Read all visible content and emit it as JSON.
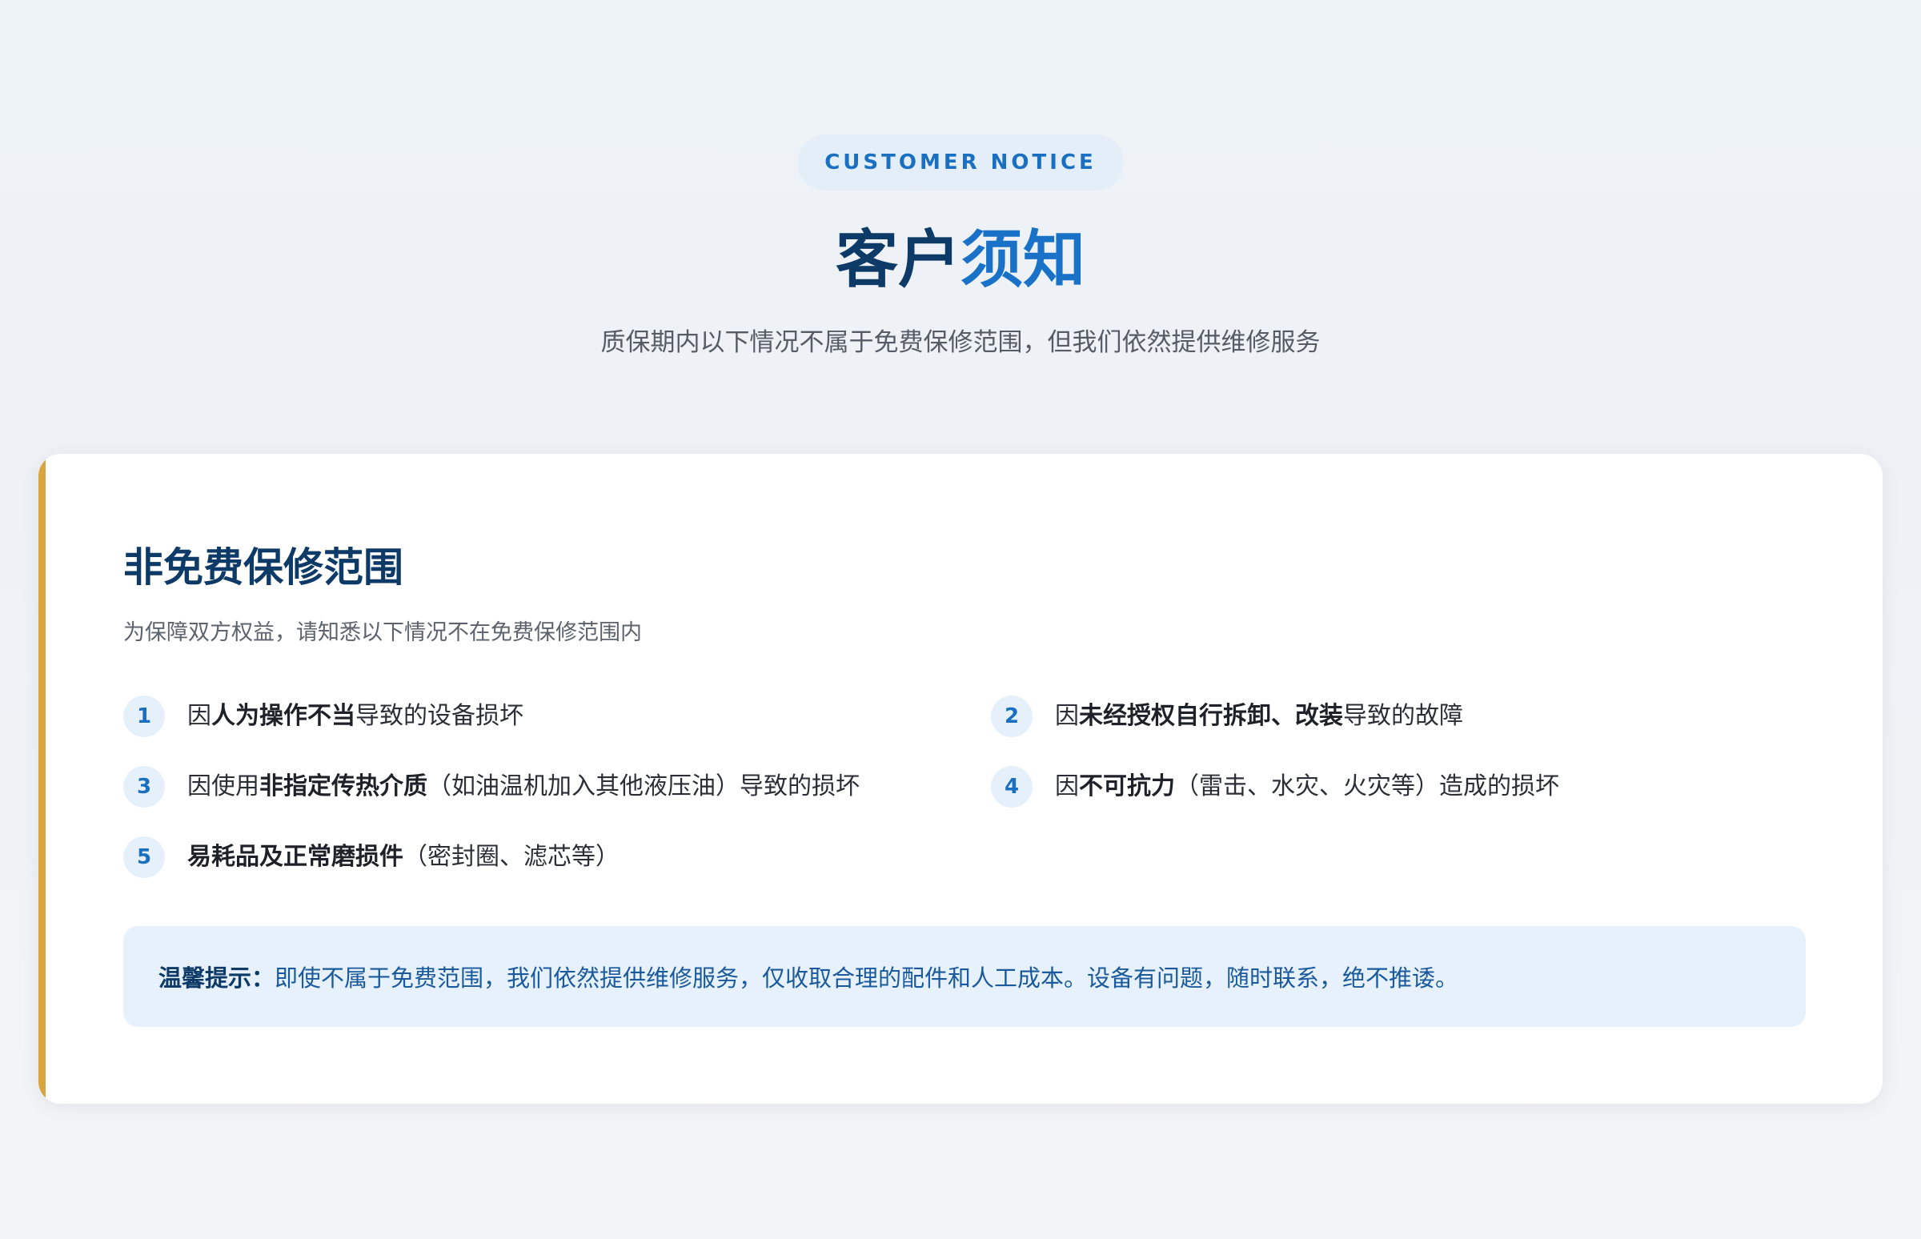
{
  "header": {
    "badge": "CUSTOMER NOTICE",
    "title_main": "客户",
    "title_accent": "须知",
    "subtitle": "质保期内以下情况不属于免费保修范围，但我们依然提供维修服务"
  },
  "card": {
    "title": "非免费保修范围",
    "subtitle": "为保障双方权益，请知悉以下情况不在免费保修范围内",
    "items": [
      {
        "num": "1",
        "pre": "因",
        "bold": "人为操作不当",
        "post": "导致的设备损坏"
      },
      {
        "num": "2",
        "pre": "因",
        "bold": "未经授权自行拆卸、改装",
        "post": "导致的故障"
      },
      {
        "num": "3",
        "pre": "因使用",
        "bold": "非指定传热介质",
        "post": "（如油温机加入其他液压油）导致的损坏"
      },
      {
        "num": "4",
        "pre": "因",
        "bold": "不可抗力",
        "post": "（雷击、水灾、火灾等）造成的损坏"
      },
      {
        "num": "5",
        "pre": "",
        "bold": "易耗品及正常磨损件",
        "post": "（密封圈、滤芯等）"
      }
    ],
    "tip_label": "温馨提示：",
    "tip_text": "即使不属于免费范围，我们依然提供维修服务，仅收取合理的配件和人工成本。设备有问题，随时联系，绝不推诿。"
  },
  "colors": {
    "accent_blue": "#1a72c8",
    "navy": "#0d3a66",
    "gold_bar": "#d8a53e",
    "tip_bg": "#e7f1fb"
  }
}
